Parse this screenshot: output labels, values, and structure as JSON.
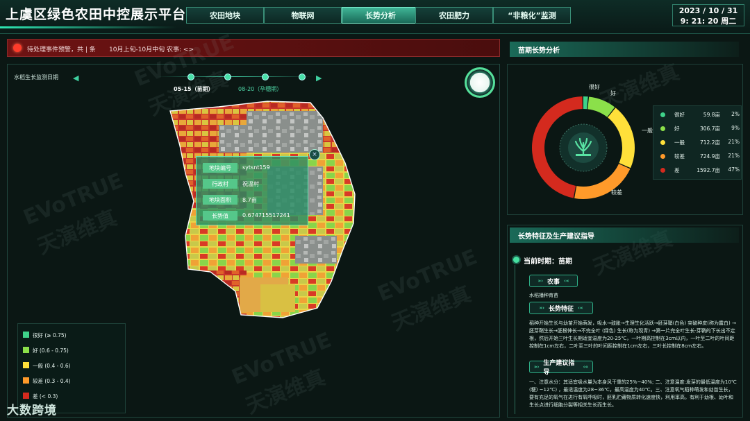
{
  "header": {
    "title": "上虞区绿色农田中控展示平台",
    "tabs": [
      {
        "label": "农田地块",
        "active": false
      },
      {
        "label": "物联网",
        "active": false
      },
      {
        "label": "长势分析",
        "active": true
      },
      {
        "label": "农田肥力",
        "active": false
      },
      {
        "label": "“非粮化”监测",
        "active": false
      }
    ],
    "date": "2023 / 10 / 31",
    "time": "9: 21: 20  周二"
  },
  "alert": {
    "text": "待处理事件预警，共 | 条",
    "period": "10月上旬-10月中旬 农事: <>"
  },
  "map": {
    "date_label": "水稻生长监测日期",
    "timeline": [
      "05-15（苗期）",
      "08-20（孕穗期）"
    ],
    "popup": {
      "rows": [
        {
          "label": "地块编号",
          "value": "sytsnt159"
        },
        {
          "label": "行政村",
          "value": "祝温村"
        },
        {
          "label": "地块面积",
          "value": "8.7亩"
        },
        {
          "label": "长势值",
          "value": "0.674715517241"
        }
      ],
      "close": "×"
    },
    "legend": [
      {
        "label": "很好  (≥ 0.75)",
        "color": "#3fd28a"
      },
      {
        "label": "好  (0.6 - 0.75)",
        "color": "#8be04a"
      },
      {
        "label": "一般  (0.4 - 0.6)",
        "color": "#ffe03a"
      },
      {
        "label": "较差  (0.3 - 0.4)",
        "color": "#ff9a2a"
      },
      {
        "label": "差  (< 0.3)",
        "color": "#d42a1e"
      }
    ]
  },
  "brand": "大数跨境",
  "watermark": [
    "EVoTRUE",
    "天演维真"
  ],
  "growth": {
    "title": "苗期长势分析",
    "center_icon": "rice-seedling-icon",
    "stats": [
      {
        "name": "很好",
        "area": "59.8亩",
        "pct": "2%",
        "color": "#3fd28a",
        "value": 59.8
      },
      {
        "name": "好",
        "area": "306.7亩",
        "pct": "9%",
        "color": "#8be04a",
        "value": 306.7
      },
      {
        "name": "一般",
        "area": "712.2亩",
        "pct": "21%",
        "color": "#ffe03a",
        "value": 712.2
      },
      {
        "name": "较差",
        "area": "724.9亩",
        "pct": "21%",
        "color": "#ff9a2a",
        "value": 724.9
      },
      {
        "name": "差",
        "area": "1592.7亩",
        "pct": "47%",
        "color": "#d42a1e",
        "value": 1592.7
      }
    ]
  },
  "advice": {
    "title": "长势特征及生产建议指导",
    "phase": "当前时期：苗期",
    "farm_label": "农事",
    "farm_text": "水稻播种育苗",
    "feature_label": "长势特征",
    "feature_text": "稻种开始生长与幼苗开始萌发，吸水→鼓胀→生理生化活跃→胚芽鞘(白色) 突破种皮(称为露白) →胚芽鞘生长→胚根伸长→不完全叶 (绿色) 生长(称为现青) →第一片完全叶生长-芽鞘的下长出不定根，然后开始三叶生长期适宜温度为20-25℃，一叶期高控制在3cm以内，一叶至二叶的叶间距控制在1cm左右，二叶至三叶的叶间距控制在1cm左右，三叶长控制在8cm左右。",
    "advice_label": "生产建议指导",
    "advice_text": "一、注意水分：其适宜吸水量为本身风干重的25%~40%; 二、注意温度:发芽的最低温度为10℃ (粳) ~12℃) ，最适温度为28~36℃，最高温度为40℃。三、注意氧气稻种萌发和幼苗生长，要有充足的氧气在进行有氧呼吸时，胚乳贮藏物质转化速度快，利用率高。有利于幼根、幼叶和生长点进行细胞分裂等相关生长而生长。"
  }
}
